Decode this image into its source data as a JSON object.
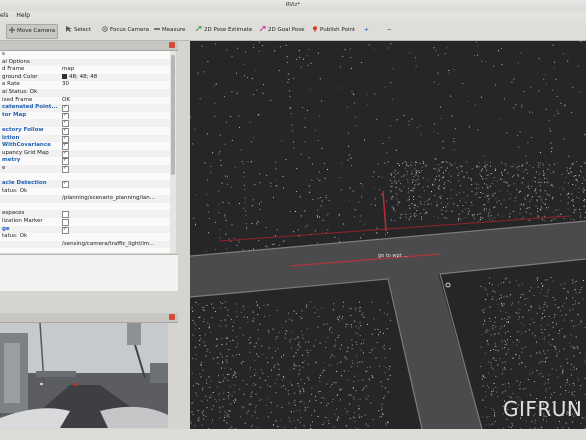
{
  "window": {
    "title": "RViz*"
  },
  "menu": {
    "items": [
      "els",
      "Help"
    ]
  },
  "toolbar": {
    "move_camera": "Move Camera",
    "select": "Select",
    "focus_camera": "Focus Camera",
    "measure": "Measure",
    "pose_estimate": "2D Pose Estimate",
    "goal_pose": "2D Goal Pose",
    "publish_point": "Publish Point",
    "plus": "+",
    "minus": "−"
  },
  "displays": {
    "rows": [
      {
        "label": "s",
        "value": "",
        "style": "plain"
      },
      {
        "label": "al Options",
        "value": "",
        "style": "plain"
      },
      {
        "label": "d Frame",
        "value": "map",
        "style": "plain"
      },
      {
        "label": "ground Color",
        "value": "48; 48; 48",
        "style": "plain",
        "swatch": true
      },
      {
        "label": "e Rate",
        "value": "30",
        "style": "plain"
      },
      {
        "label": "al Status: Ok",
        "value": "",
        "style": "plain"
      },
      {
        "label": "ixed Frame",
        "value": "OK",
        "style": "plain"
      },
      {
        "label": "catenated Point...",
        "value": "",
        "style": "blue",
        "check": true
      },
      {
        "label": "tor Map",
        "value": "",
        "style": "blue",
        "check": true
      },
      {
        "label": "",
        "value": "",
        "style": "plain",
        "check": true
      },
      {
        "label": "ectory Follow",
        "value": "",
        "style": "blue",
        "check": true
      },
      {
        "label": "iction",
        "value": "",
        "style": "blue",
        "check": true
      },
      {
        "label": "WithCovariance",
        "value": "",
        "style": "blue",
        "check": true
      },
      {
        "label": "upancy Grid Map",
        "value": "",
        "style": "plain",
        "check": true
      },
      {
        "label": "metry",
        "value": "",
        "style": "blue",
        "check": true
      },
      {
        "label": "e",
        "value": "",
        "style": "plain",
        "check": true
      },
      {
        "label": "",
        "value": "",
        "style": "plain"
      },
      {
        "label": "acle Detection",
        "value": "",
        "style": "blue",
        "check": true
      },
      {
        "label": "tatus: Ok",
        "value": "",
        "style": "plain"
      },
      {
        "label": "",
        "value": "/planning/scenario_planning/lan...",
        "style": "plain"
      },
      {
        "label": "",
        "value": "",
        "style": "plain"
      },
      {
        "label": "espaces",
        "value": "",
        "style": "plain",
        "check": false
      },
      {
        "label": "lization Marker",
        "value": "",
        "style": "plain",
        "check": false
      },
      {
        "label": "ge",
        "value": "",
        "style": "blue",
        "check": true
      },
      {
        "label": "tatus: Ok",
        "value": "",
        "style": "plain"
      },
      {
        "label": "",
        "value": "/sensing/camera/traffic_light/im...",
        "style": "plain"
      }
    ]
  },
  "viewport": {
    "label": "go to wpt ..."
  },
  "watermark": {
    "text": "GIFRUN"
  }
}
